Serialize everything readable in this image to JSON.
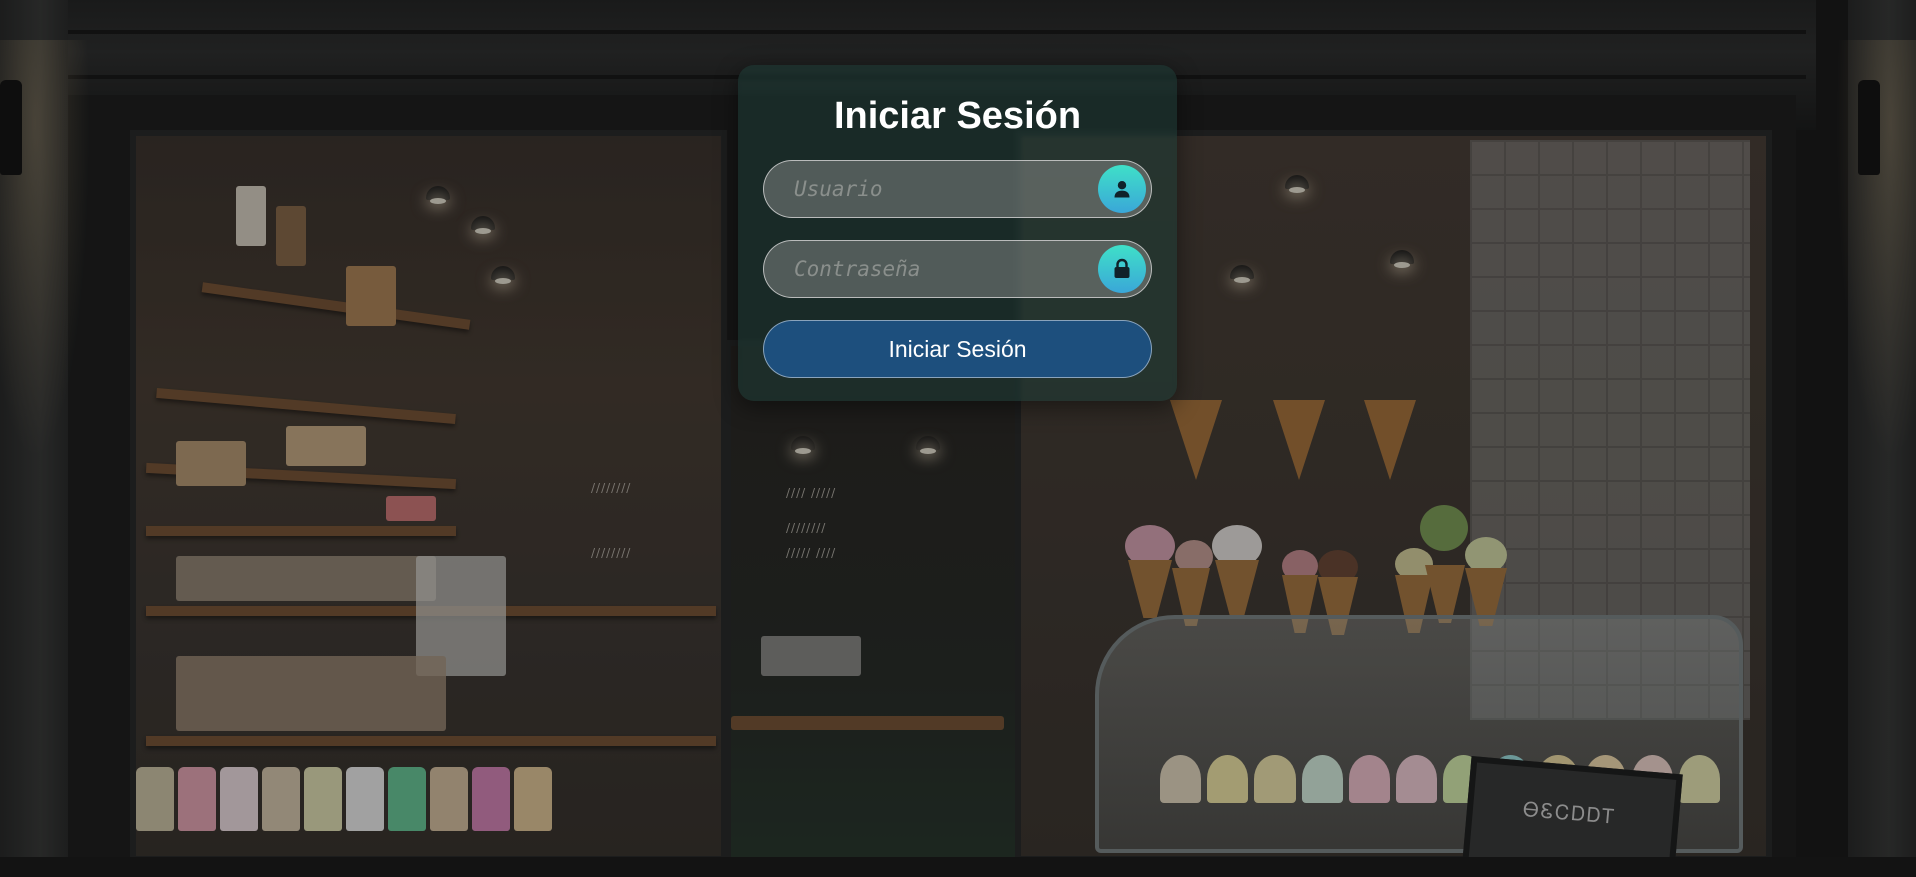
{
  "login": {
    "title": "Iniciar Sesión",
    "username_placeholder": "Usuario",
    "username_value": "",
    "username_icon": "user-icon",
    "password_placeholder": "Contraseña",
    "password_value": "",
    "password_icon": "lock-icon",
    "submit_label": "Iniciar Sesión"
  },
  "background": {
    "scene": "ice-cream-shop-storefront",
    "sign_text": "ᎾᏋᏟᎠᎠᎢ"
  },
  "colors": {
    "card": "#1e3c37",
    "icon_gradient_start": "#3fe0c8",
    "icon_gradient_end": "#3aa7d8",
    "button": "#1d4f7d",
    "text": "#ffffff"
  }
}
